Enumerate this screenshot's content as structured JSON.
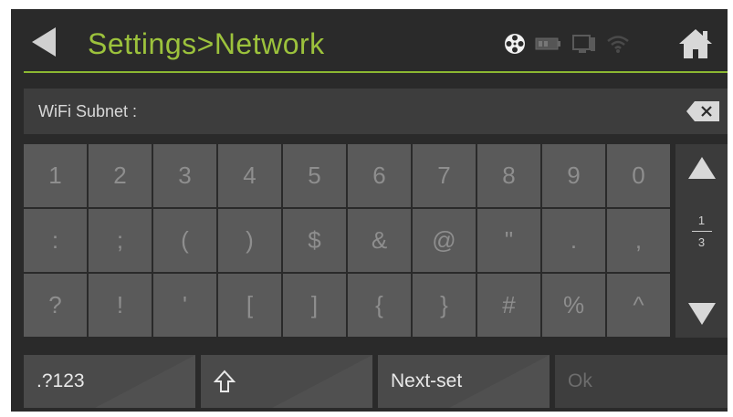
{
  "header": {
    "title": "Settings>Network",
    "back_icon": "back-arrow-icon",
    "home_icon": "home-icon",
    "status_icons": [
      "film-reel-icon",
      "battery-icon",
      "device-icon",
      "wifi-icon"
    ],
    "accent_color": "#9cc23c"
  },
  "input": {
    "label": "WiFi Subnet :",
    "value": "",
    "clear_icon": "backspace-icon"
  },
  "keyboard": {
    "rows": [
      [
        "1",
        "2",
        "3",
        "4",
        "5",
        "6",
        "7",
        "8",
        "9",
        "0"
      ],
      [
        ":",
        ";",
        "(",
        ")",
        "$",
        "&",
        "@",
        "\"",
        ".",
        ","
      ],
      [
        "?",
        "!",
        "'",
        "[",
        "]",
        "{",
        "}",
        "#",
        "%",
        "^"
      ]
    ]
  },
  "pager": {
    "current": "1",
    "total": "3",
    "up_icon": "arrow-up-icon",
    "down_icon": "arrow-down-icon"
  },
  "bottom": {
    "symbols_label": ".?123",
    "shift_icon": "shift-arrow-icon",
    "next_set_label": "Next-set",
    "ok_label": "Ok"
  }
}
